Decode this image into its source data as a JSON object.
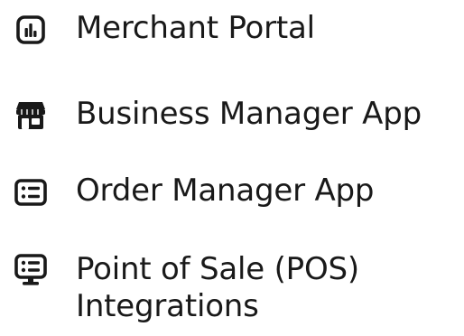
{
  "menu": {
    "items": [
      {
        "label": "Merchant Portal",
        "icon": "chart-square-icon"
      },
      {
        "label": "Business Manager App",
        "icon": "storefront-icon"
      },
      {
        "label": "Order Manager App",
        "icon": "list-card-icon"
      },
      {
        "label": "Point of Sale (POS)\nIntegrations",
        "icon": "pos-terminal-icon"
      }
    ]
  },
  "colors": {
    "text": "#191919",
    "icon": "#191919",
    "background": "#ffffff"
  }
}
